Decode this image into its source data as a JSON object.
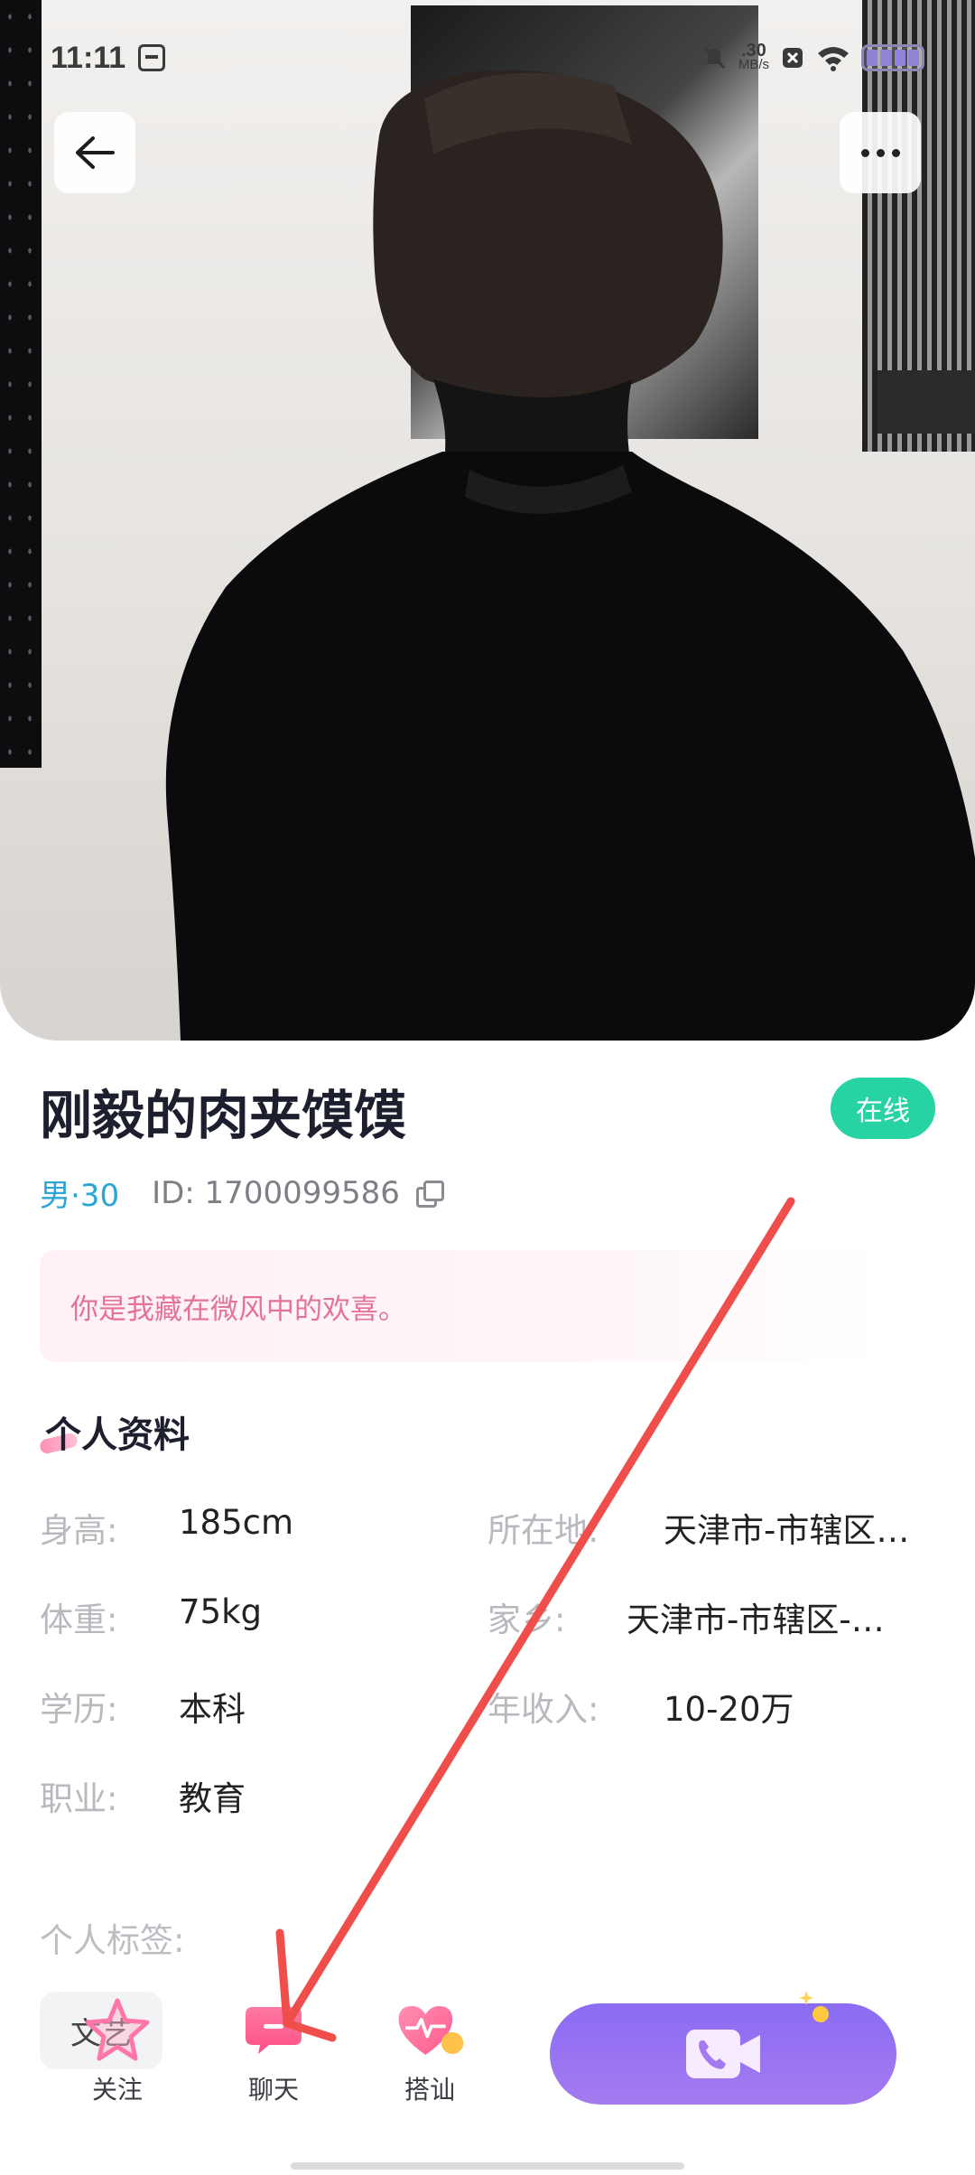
{
  "status_bar": {
    "time": "11:11",
    "speed_value": ".30",
    "speed_unit": "MB/s"
  },
  "profile": {
    "nickname": "刚毅的肉夹馍馍",
    "online_status": "在线",
    "gender_age": "男·30",
    "user_id": "ID: 1700099586",
    "signature": "你是我藏在微风中的欢喜。"
  },
  "personal_info": {
    "title": "个人资料",
    "fields": [
      {
        "label": "身高:",
        "value": "185cm"
      },
      {
        "label": "所在地:",
        "value": "天津市-市辖区…"
      },
      {
        "label": "体重:",
        "value": "75kg"
      },
      {
        "label": "家乡:",
        "value": "天津市-市辖区-…"
      },
      {
        "label": "学历:",
        "value": "本科"
      },
      {
        "label": "年收入:",
        "value": "10-20万"
      },
      {
        "label": "职业:",
        "value": "教育"
      }
    ]
  },
  "tags": {
    "label": "个人标签:",
    "items": [
      "文艺"
    ]
  },
  "bottom_bar": {
    "follow_label": "关注",
    "chat_label": "聊天",
    "greet_label": "搭讪"
  },
  "colors": {
    "online_green": "#27d2a3",
    "gender_blue": "#2aa6d6",
    "signature_pink": "#e4729a",
    "call_purple": "#8a6cf3",
    "annotation_red": "#ef4e4a"
  },
  "icons": [
    "back-arrow-icon",
    "more-dots-icon",
    "copy-icon",
    "star-icon",
    "chat-bubble-icon",
    "heart-pulse-icon",
    "video-call-icon"
  ]
}
